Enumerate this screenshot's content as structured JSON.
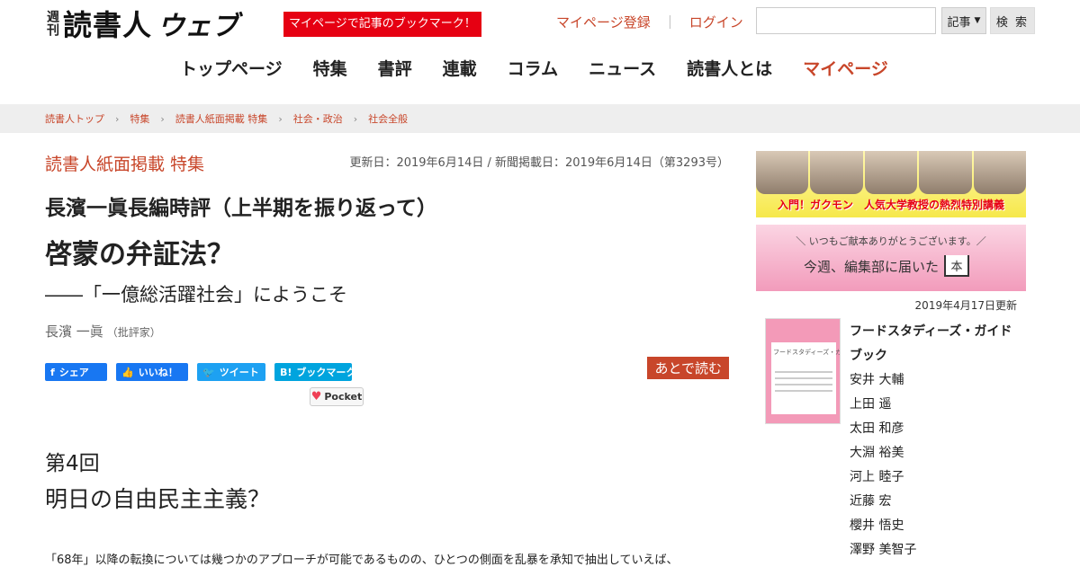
{
  "header": {
    "logo_small": "週刊",
    "logo_main": "読書人",
    "logo_web": "ウェブ",
    "bookmark_promo": "マイページで記事のブックマーク！",
    "mypage_register": "マイページ登録",
    "separator": "｜",
    "login": "ログイン",
    "search": {
      "value": "",
      "placeholder": "",
      "select_value": "記事",
      "button_label": "検 索"
    }
  },
  "nav": {
    "items": [
      "トップページ",
      "特集",
      "書評",
      "連載",
      "コラム",
      "ニュース",
      "読書人とは"
    ],
    "mypage": "マイページ"
  },
  "breadcrumb": [
    "読書人トップ",
    "特集",
    "読書人紙面掲載 特集",
    "社会・政治",
    "社会全般"
  ],
  "article": {
    "section": "読書人紙面掲載 特集",
    "dates": "更新日：2019年6月14日 / 新聞掲載日：2019年6月14日（第3293号）",
    "subtitle": "長濱一眞長編時評（上半期を振り返って）",
    "title": "啓蒙の弁証法？",
    "tagline": "――「一億総活躍社会」にようこそ",
    "author_name": "長濱 一眞",
    "author_role": "（批評家）",
    "share": {
      "facebook": "シェア",
      "like": "いいね！",
      "twitter": "ツイート",
      "hatena": "ブックマーク",
      "pocket": "Pocket",
      "read_later": "あとで読む"
    },
    "episode": "第4回",
    "episode_title": "明日の自由民主主義？",
    "body_first_line": "「68年」以降の転換については幾つかのアプローチが可能であるものの、ひとつの側面を乱暴を承知で抽出していえば、"
  },
  "sidebar": {
    "banner1_text": "入門！ガクモン　人気大学教授の熱烈特別講義",
    "banner2_top": "＼ いつもご献本ありがとうございます。／",
    "banner2_main": "今週、編集部に届いた",
    "banner2_book": "本",
    "update_date": "2019年4月17日更新",
    "book": {
      "cover_title": "フードスタディーズ・ガイドブック",
      "title": "フードスタディーズ・ガイドブック",
      "authors": [
        "安井 大輔",
        "上田 遥",
        "太田 和彦",
        "大淵 裕美",
        "河上 睦子",
        "近藤 宏",
        "櫻井 悟史",
        "澤野 美智子"
      ]
    }
  },
  "colors": {
    "accent": "#c8462a",
    "promo_red": "#e60012",
    "facebook": "#1877f2",
    "twitter": "#1da1f2",
    "hatena": "#00a4de"
  }
}
